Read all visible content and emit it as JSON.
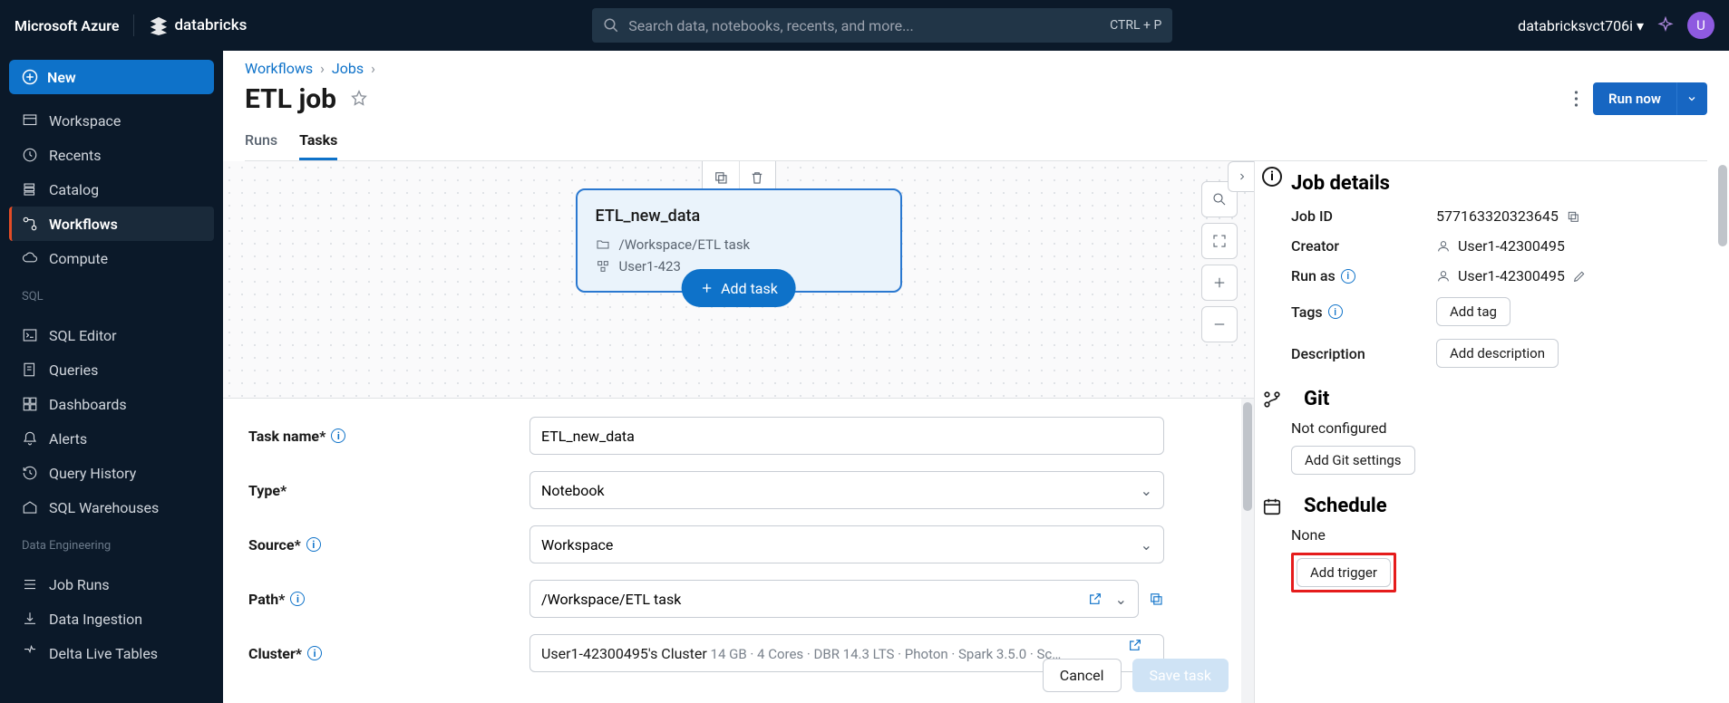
{
  "topbar": {
    "azure": "Microsoft Azure",
    "brand": "databricks",
    "search_placeholder": "Search data, notebooks, recents, and more...",
    "shortcut": "CTRL + P",
    "user": "databricksvct706i",
    "avatar_initial": "U"
  },
  "sidebar": {
    "new": "New",
    "items_top": [
      {
        "label": "Workspace"
      },
      {
        "label": "Recents"
      },
      {
        "label": "Catalog"
      },
      {
        "label": "Workflows"
      },
      {
        "label": "Compute"
      }
    ],
    "sql_label": "SQL",
    "items_sql": [
      {
        "label": "SQL Editor"
      },
      {
        "label": "Queries"
      },
      {
        "label": "Dashboards"
      },
      {
        "label": "Alerts"
      },
      {
        "label": "Query History"
      },
      {
        "label": "SQL Warehouses"
      }
    ],
    "de_label": "Data Engineering",
    "items_de": [
      {
        "label": "Job Runs"
      },
      {
        "label": "Data Ingestion"
      },
      {
        "label": "Delta Live Tables"
      }
    ]
  },
  "breadcrumb": {
    "a": "Workflows",
    "b": "Jobs"
  },
  "page": {
    "title": "ETL job",
    "run_now": "Run now"
  },
  "tabs": {
    "runs": "Runs",
    "tasks": "Tasks"
  },
  "task_node": {
    "title": "ETL_new_data",
    "path": "/Workspace/ETL task",
    "cluster_owner": "User1-423",
    "add_task": "Add task"
  },
  "form": {
    "task_name_label": "Task name*",
    "task_name_value": "ETL_new_data",
    "type_label": "Type*",
    "type_value": "Notebook",
    "source_label": "Source*",
    "source_value": "Workspace",
    "path_label": "Path*",
    "path_value": "/Workspace/ETL task",
    "cluster_label": "Cluster*",
    "cluster_value": "User1-42300495's Cluster",
    "cluster_detail": "  14 GB · 4 Cores · DBR 14.3 LTS · Photon · Spark 3.5.0 · Sc…",
    "cancel": "Cancel",
    "save": "Save task"
  },
  "details": {
    "title": "Job details",
    "job_id_label": "Job ID",
    "job_id": "577163320323645",
    "creator_label": "Creator",
    "creator": "User1-42300495",
    "run_as_label": "Run as",
    "run_as": "User1-42300495",
    "tags_label": "Tags",
    "add_tag": "Add tag",
    "description_label": "Description",
    "add_description": "Add description",
    "git_title": "Git",
    "git_status": "Not configured",
    "add_git": "Add Git settings",
    "schedule_title": "Schedule",
    "schedule_status": "None",
    "add_trigger": "Add trigger"
  }
}
